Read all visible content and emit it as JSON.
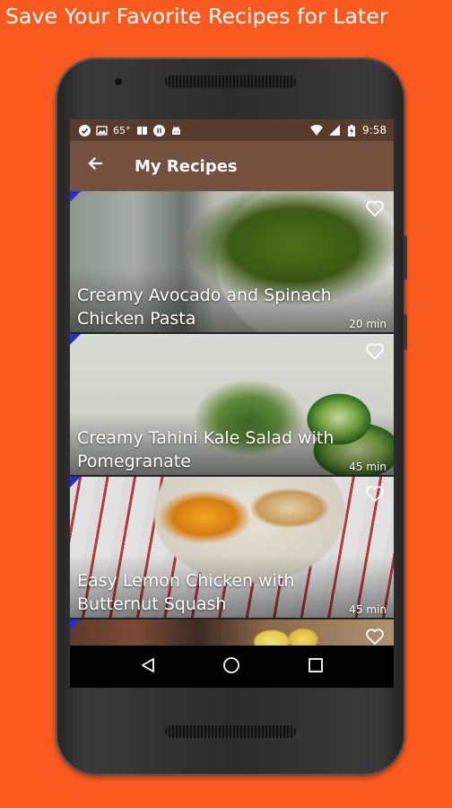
{
  "promo": {
    "headline": "Save Your Favorite Recipes for Later"
  },
  "status_bar": {
    "temperature": "65°",
    "time": "9:58",
    "icons": [
      "check-circle-icon",
      "image-icon",
      "book-icon",
      "pause-icon",
      "android-icon",
      "wifi-icon",
      "signal-icon",
      "battery-charging-icon"
    ]
  },
  "app_bar": {
    "title": "My Recipes",
    "back_icon": "arrow-back-icon"
  },
  "recipes": [
    {
      "title": "Creamy Avocado and Spinach Chicken Pasta",
      "time": "20 min",
      "favorite_icon": "heart-outline-icon"
    },
    {
      "title": "Creamy Tahini Kale Salad with Pomegranate",
      "time": "45 min",
      "favorite_icon": "heart-outline-icon"
    },
    {
      "title": "Easy Lemon Chicken with Butternut Squash",
      "time": "45 min",
      "favorite_icon": "heart-outline-icon"
    },
    {
      "title": "",
      "time": "",
      "favorite_icon": "heart-outline-icon"
    }
  ],
  "nav_bar": {
    "icons": [
      "back-triangle-icon",
      "home-circle-icon",
      "recents-square-icon"
    ]
  },
  "colors": {
    "background": "#fa5a1e",
    "status_bar": "#583b2c",
    "app_bar": "#74503e",
    "corner_marker": "#2a2ad6"
  }
}
